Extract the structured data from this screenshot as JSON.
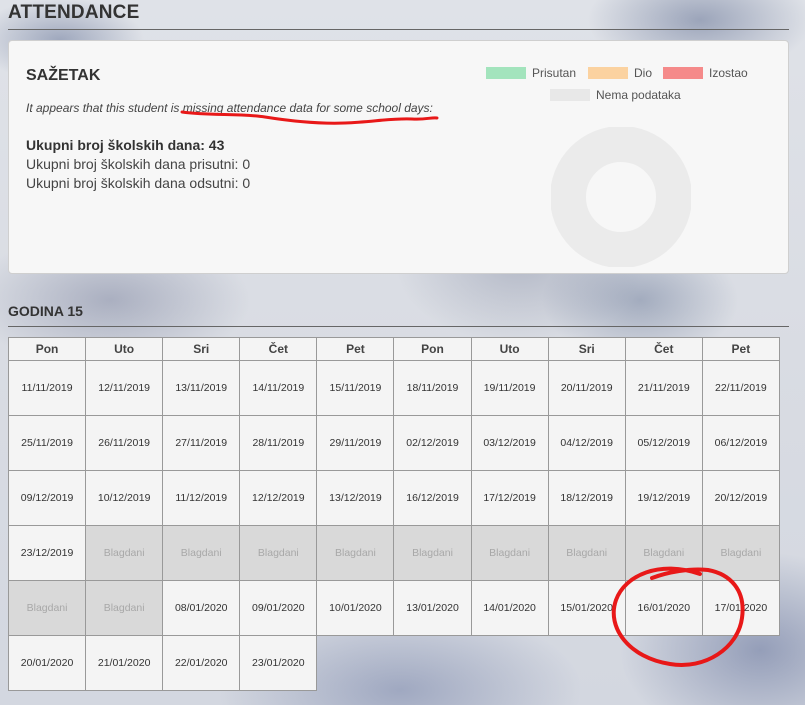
{
  "header": {
    "title": "ATTENDANCE"
  },
  "summary": {
    "title": "SAŽETAK",
    "missing_note": "It appears that this student is missing attendance data for some school days:",
    "total_days": "Ukupni broj školskih dana: 43",
    "present_days": "Ukupni broj školskih dana prisutni: 0",
    "absent_days": "Ukupni broj školskih dana odsutni: 0"
  },
  "legend": {
    "items": [
      {
        "label": "Prisutan",
        "color": "#a3e4bd"
      },
      {
        "label": "Dio",
        "color": "#fbd2a0"
      },
      {
        "label": "Izostao",
        "color": "#f58a8a"
      },
      {
        "label": "Nema podataka",
        "color": "#e8e8e8"
      }
    ]
  },
  "donut": {
    "no_data_fraction": 1.0,
    "color": "#ebebeb"
  },
  "year": {
    "title": "GODINA 15"
  },
  "calendar": {
    "weekdays": [
      "Pon",
      "Uto",
      "Sri",
      "Čet",
      "Pet",
      "Pon",
      "Uto",
      "Sri",
      "Čet",
      "Pet"
    ],
    "rows": [
      [
        "11/11/2019",
        "12/11/2019",
        "13/11/2019",
        "14/11/2019",
        "15/11/2019",
        "18/11/2019",
        "19/11/2019",
        "20/11/2019",
        "21/11/2019",
        "22/11/2019"
      ],
      [
        "25/11/2019",
        "26/11/2019",
        "27/11/2019",
        "28/11/2019",
        "29/11/2019",
        "02/12/2019",
        "03/12/2019",
        "04/12/2019",
        "05/12/2019",
        "06/12/2019"
      ],
      [
        "09/12/2019",
        "10/12/2019",
        "11/12/2019",
        "12/12/2019",
        "13/12/2019",
        "16/12/2019",
        "17/12/2019",
        "18/12/2019",
        "19/12/2019",
        "20/12/2019"
      ],
      [
        "23/12/2019",
        "Blagdani",
        "Blagdani",
        "Blagdani",
        "Blagdani",
        "Blagdani",
        "Blagdani",
        "Blagdani",
        "Blagdani",
        "Blagdani"
      ],
      [
        "Blagdani",
        "Blagdani",
        "08/01/2020",
        "09/01/2020",
        "10/01/2020",
        "13/01/2020",
        "14/01/2020",
        "15/01/2020",
        "16/01/2020",
        "17/01/2020"
      ],
      [
        "20/01/2020",
        "21/01/2020",
        "22/01/2020",
        "23/01/2020",
        "",
        "",
        "",
        "",
        "",
        ""
      ]
    ],
    "holiday_label": "Blagdani"
  },
  "colors": {
    "annotation_red": "#e81818"
  }
}
